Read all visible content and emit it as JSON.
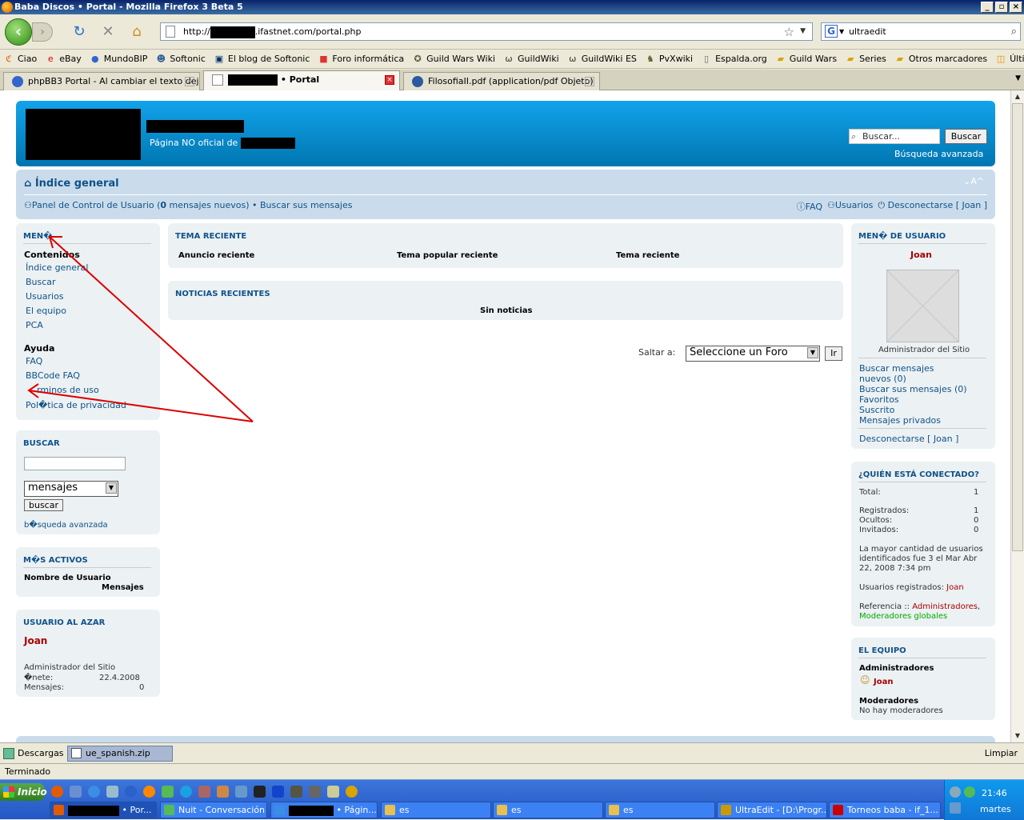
{
  "window": {
    "title": "Baba Discos • Portal - Mozilla Firefox 3 Beta 5",
    "controls": [
      "_",
      "▫",
      "×"
    ]
  },
  "nav": {
    "url_prefix": "http://",
    "url_suffix": ".ifastnet.com/portal.php",
    "search_value": "ultraedit",
    "search_engine": "G"
  },
  "bookmarks": [
    "Ciao",
    "eBay",
    "MundoBIP",
    "Softonic",
    "El blog de Softonic",
    "Foro informática",
    "Guild Wars Wiki",
    "GuildWiki",
    "GuildWiki ES",
    "PvXwiki",
    "Espalda.org",
    "Guild Wars",
    "Series",
    "Otros marcadores",
    "Últimas noticias"
  ],
  "tabs": [
    {
      "label": "phpBB3 Portal - Al cambiar el texto dej..."
    },
    {
      "label": "• Portal"
    },
    {
      "label": "FilosofiaII.pdf (application/pdf Objeto)"
    }
  ],
  "site": {
    "description": "Página NO oficial de",
    "search_placeholder": "Buscar...",
    "search_button": "Buscar",
    "advanced_search": "Búsqueda avanzada"
  },
  "navstrip": {
    "home": "Índice general",
    "font_resize": "⌄A^",
    "ucp_prefix": "Panel de Control de Usuario (",
    "ucp_count": "0",
    "ucp_suffix": " mensajes nuevos) • Buscar sus mensajes",
    "faq": "FAQ",
    "users": "Usuarios",
    "logout": "Desconectarse [ Joan ]"
  },
  "left_menu": {
    "title": "MEN�",
    "contents_heading": "Contenidos",
    "contents": [
      "Índice general",
      "Buscar",
      "Usuarios",
      "El equipo",
      "PCA"
    ],
    "help_heading": "Ayuda",
    "help": [
      "FAQ",
      "BBCode FAQ",
      "Términos de uso",
      "Pol�tica de privacidad"
    ],
    "help_overlay_text": "rminos de uso"
  },
  "left_search": {
    "title": "BUSCAR",
    "select_value": "mensajes",
    "button": "buscar",
    "advanced": "b�squeda avanzada"
  },
  "most_active": {
    "title": "M�S ACTIVOS",
    "col1": "Nombre de Usuario",
    "col2": "Mensajes"
  },
  "random_user": {
    "title": "USUARIO AL AZAR",
    "name": "Joan",
    "rank": "Administrador del Sitio",
    "joined_label": "�nete:",
    "joined_value": "22.4.2008",
    "posts_label": "Mensajes:",
    "posts_value": "0"
  },
  "recent": {
    "title": "TEMA RECIENTE",
    "cols": [
      "Anuncio reciente",
      "Tema popular reciente",
      "Tema reciente"
    ]
  },
  "news": {
    "title": "NOTICIAS RECIENTES",
    "empty": "Sin noticias"
  },
  "jump": {
    "label": "Saltar a:",
    "select_value": "Seleccione un Foro",
    "button": "Ir"
  },
  "user_menu": {
    "title": "MEN� DE USUARIO",
    "name": "Joan",
    "rank": "Administrador del Sitio",
    "links": [
      "Buscar mensajes",
      "nuevos (0)",
      "Buscar sus mensajes (0)",
      "Favoritos",
      "Suscrito",
      "Mensajes privados"
    ],
    "logout": "Desconectarse [ Joan ]"
  },
  "online": {
    "title": "¿QUIÉN ESTÁ CONECTADO?",
    "total_label": "Total:",
    "total": "1",
    "registered_label": "Registrados:",
    "registered": "1",
    "hidden_label": "Ocultos:",
    "hidden": "0",
    "guests_label": "Invitados:",
    "guests": "0",
    "record_1": "La mayor cantidad de usuarios",
    "record_2": "identificados fue 3 el Mar Abr",
    "record_3": "22, 2008 7:34 pm",
    "registered_users_label": "Usuarios registrados:",
    "registered_users": "Joan",
    "legend_label": "Referencia ::",
    "legend_admins": "Administradores",
    "legend_comma": ",",
    "legend_mods": "Moderadores globales"
  },
  "team": {
    "title": "EL EQUIPO",
    "admins_heading": "Administradores",
    "admin": "Joan",
    "mods_heading": "Moderadores",
    "mods_none": "No hay moderadores"
  },
  "downloads": {
    "label": "Descargas",
    "item": "ue_spanish.zip",
    "clear": "Limpiar"
  },
  "status": {
    "text": "Terminado"
  },
  "taskbar": {
    "start": "Inicio",
    "tasks": [
      "• Por...",
      "Nuit - Conversación",
      "• Págin...",
      "es",
      "es",
      "es",
      "UltraEdit - [D:\\Progr...",
      "Torneos baba - if_1..."
    ],
    "clock": "21:46",
    "day": "martes"
  },
  "colors": {
    "link": "#105289",
    "header_blue": "#0f8fd4",
    "admin_red": "#aa0000",
    "mod_green": "#00aa00",
    "annotation_red": "#dd0000"
  }
}
